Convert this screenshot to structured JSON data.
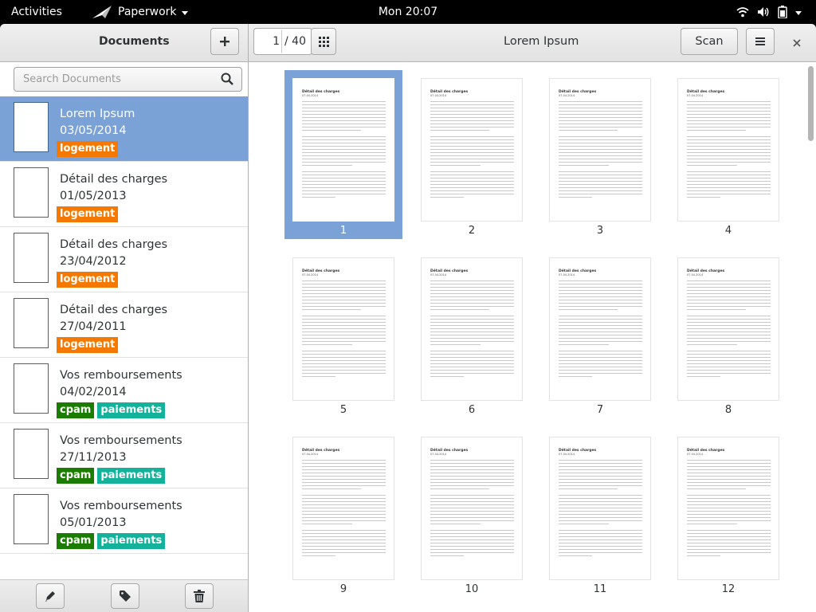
{
  "topbar": {
    "activities": "Activities",
    "app_name": "Paperwork",
    "clock": "Mon 20:07"
  },
  "sidebar": {
    "title": "Documents",
    "add_label": "+",
    "search_placeholder": "Search Documents",
    "documents": [
      {
        "title": "Lorem Ipsum",
        "date": "03/05/2014",
        "tags": [
          "logement"
        ],
        "selected": true
      },
      {
        "title": "Détail des charges",
        "date": "01/05/2013",
        "tags": [
          "logement"
        ]
      },
      {
        "title": "Détail des charges",
        "date": "23/04/2012",
        "tags": [
          "logement"
        ]
      },
      {
        "title": "Détail des charges",
        "date": "27/04/2011",
        "tags": [
          "logement"
        ]
      },
      {
        "title": "Vos remboursements",
        "date": "04/02/2014",
        "tags": [
          "cpam",
          "paiements"
        ]
      },
      {
        "title": "Vos remboursements",
        "date": "27/11/2013",
        "tags": [
          "cpam",
          "paiements"
        ]
      },
      {
        "title": "Vos remboursements",
        "date": "05/01/2013",
        "tags": [
          "cpam",
          "paiements"
        ]
      }
    ],
    "tag_colors": {
      "logement": "#f57900",
      "cpam": "#1a7d00",
      "paiements": "#12b39a"
    }
  },
  "viewer": {
    "current_page": "1",
    "page_total": "/ 40",
    "doc_title": "Lorem Ipsum",
    "scan_label": "Scan",
    "page_heading": "Détail des charges",
    "page_subheading": "07.04.2014",
    "pages": [
      {
        "label": "1",
        "selected": true
      },
      {
        "label": "2"
      },
      {
        "label": "3"
      },
      {
        "label": "4"
      },
      {
        "label": "5"
      },
      {
        "label": "6"
      },
      {
        "label": "7"
      },
      {
        "label": "8"
      },
      {
        "label": "9"
      },
      {
        "label": "10"
      },
      {
        "label": "11"
      },
      {
        "label": "12"
      }
    ]
  },
  "colors": {
    "selection": "#7aa2d6",
    "accent_text": "#2e3436"
  }
}
